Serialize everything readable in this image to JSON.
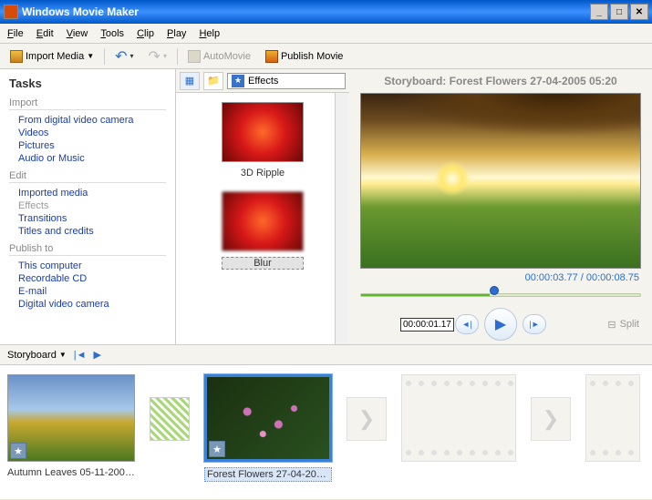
{
  "window": {
    "title": "Windows Movie Maker"
  },
  "menu": {
    "file": "File",
    "edit": "Edit",
    "view": "View",
    "tools": "Tools",
    "clip": "Clip",
    "play": "Play",
    "help": "Help"
  },
  "toolbar": {
    "import": "Import Media",
    "automovie": "AutoMovie",
    "publish": "Publish Movie"
  },
  "tasks": {
    "heading": "Tasks",
    "import": {
      "header": "Import",
      "camera": "From digital video camera",
      "videos": "Videos",
      "pictures": "Pictures",
      "audio": "Audio or Music"
    },
    "edit": {
      "header": "Edit",
      "imported": "Imported media",
      "effects": "Effects",
      "transitions": "Transitions",
      "titles": "Titles and credits"
    },
    "publish": {
      "header": "Publish to",
      "computer": "This computer",
      "cd": "Recordable CD",
      "email": "E-mail",
      "dvcam": "Digital video camera"
    }
  },
  "collection": {
    "dropdown": "Effects",
    "items": [
      {
        "label": "3D Ripple"
      },
      {
        "label": "Blur"
      }
    ]
  },
  "preview": {
    "title": "Storyboard: Forest Flowers 27-04-2005 05:20",
    "timedisplay": "00:00:03.77 / 00:00:08.75",
    "timecode": "00:00:01.17",
    "split": "Split"
  },
  "storyboard": {
    "label": "Storyboard",
    "clips": [
      {
        "label": "Autumn Leaves 05-11-2005..."
      },
      {
        "label": "Forest Flowers 27-04-2005 ..."
      }
    ]
  }
}
